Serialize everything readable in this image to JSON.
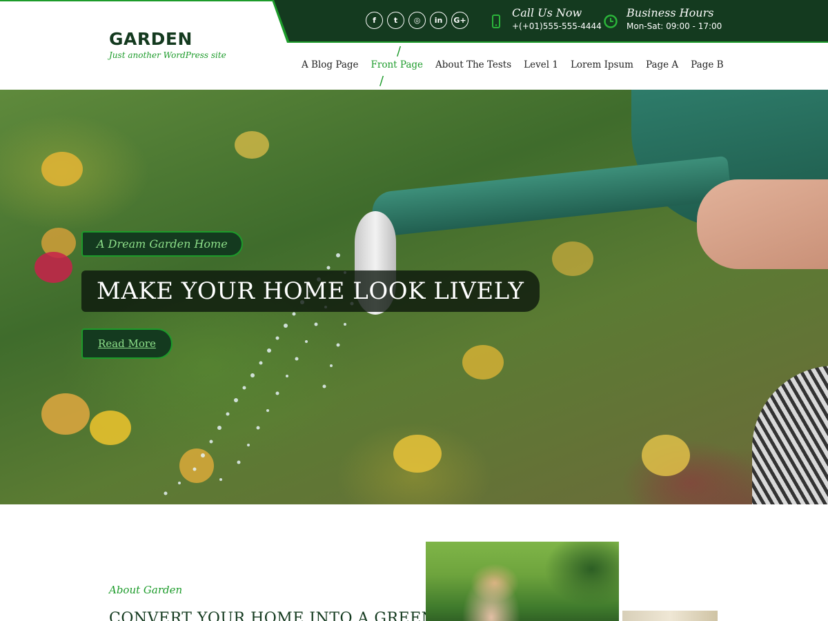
{
  "site": {
    "title": "GARDEN",
    "tagline": "Just another WordPress site"
  },
  "topbar": {
    "social": [
      {
        "icon": "facebook-icon",
        "glyph": "f"
      },
      {
        "icon": "twitter-icon",
        "glyph": "t"
      },
      {
        "icon": "instagram-icon",
        "glyph": "◎"
      },
      {
        "icon": "linkedin-icon",
        "glyph": "in"
      },
      {
        "icon": "google-plus-icon",
        "glyph": "G+"
      }
    ],
    "call": {
      "title": "Call Us Now",
      "value": "+(+01)555-555-4444",
      "icon": "phone-icon"
    },
    "hours": {
      "title": "Business Hours",
      "value": "Mon-Sat: 09:00 - 17:00",
      "icon": "clock-icon"
    }
  },
  "nav": {
    "items": [
      {
        "label": "A Blog Page"
      },
      {
        "label": "Front Page"
      },
      {
        "label": "About The Tests"
      },
      {
        "label": "Level 1"
      },
      {
        "label": "Lorem Ipsum"
      },
      {
        "label": "Page A"
      },
      {
        "label": "Page B"
      }
    ],
    "active": "Front Page"
  },
  "hero": {
    "tag": "A Dream Garden Home",
    "title": "MAKE YOUR HOME LOOK LIVELY",
    "button": "Read More"
  },
  "about": {
    "subtitle": "About Garden",
    "title": "CONVERT YOUR HOME INTO A GREEN"
  },
  "colors": {
    "primary_dark": "#143a1f",
    "accent_green": "#1c9b2a",
    "light_green_text": "#8ee08a"
  }
}
